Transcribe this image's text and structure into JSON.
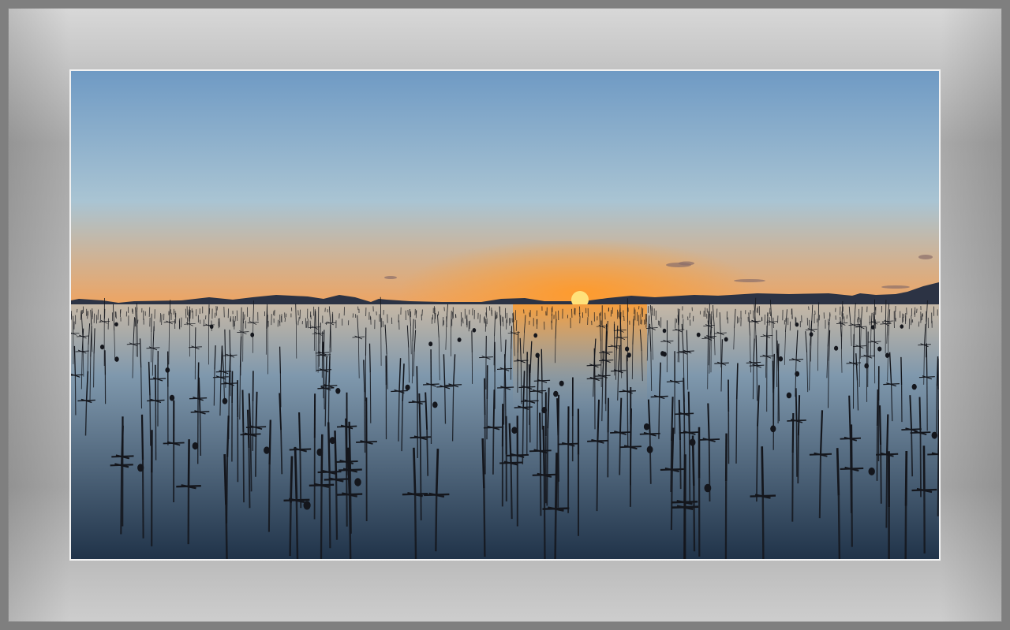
{
  "scene": {
    "subject": "sunset-over-seaweed-farm",
    "colors": {
      "sky_top": "#6f9ac4",
      "sky_mid": "#a9c4d3",
      "sky_horizon": "#f0a35e",
      "sun_glow": "#ff9a2a",
      "sun_core": "#ffe27a",
      "mountains": "#2c3344",
      "water_top": "#c6b8a6",
      "water_mid": "#7f98ad",
      "water_bottom": "#203349",
      "poles": "#14161c"
    }
  }
}
